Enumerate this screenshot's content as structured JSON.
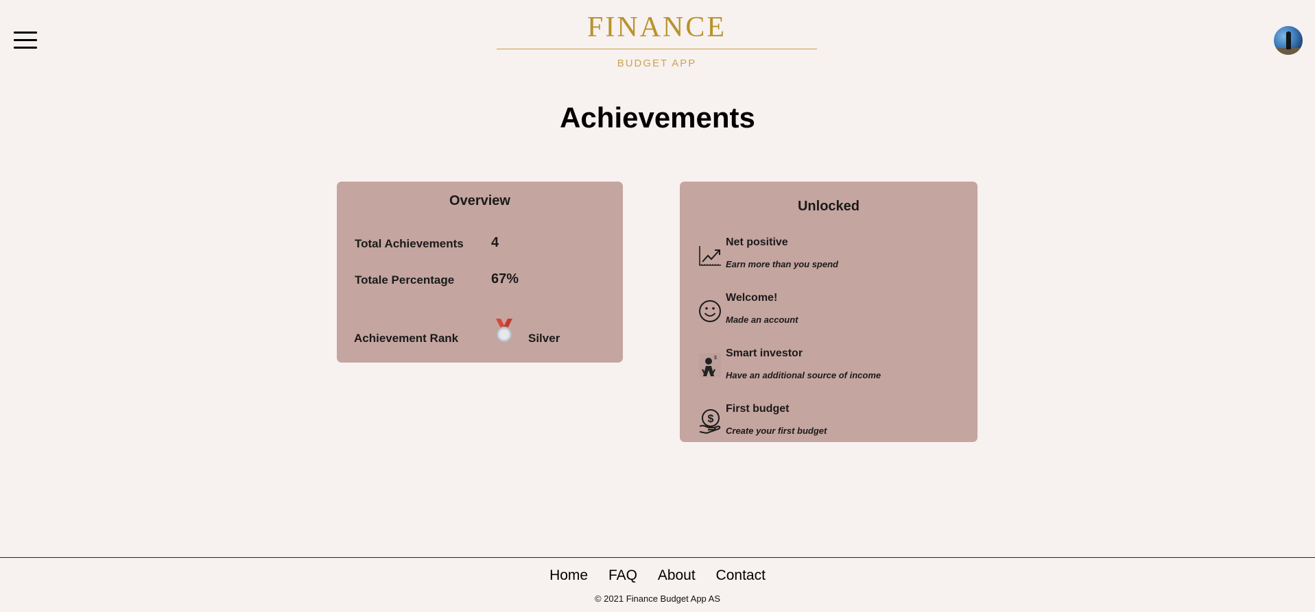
{
  "header": {
    "logo_title": "FINANCE",
    "logo_subtitle": "BUDGET APP",
    "menu_icon": "hamburger-menu-icon",
    "avatar_icon": "user-avatar"
  },
  "page": {
    "title": "Achievements"
  },
  "overview": {
    "title": "Overview",
    "total_label": "Total Achievements",
    "total_value": "4",
    "percentage_label": "Totale Percentage",
    "percentage_value": "67%",
    "rank_label": "Achievement Rank",
    "rank_icon": "silver-medal-icon",
    "rank_value": "Silver"
  },
  "unlocked": {
    "title": "Unlocked",
    "items": [
      {
        "name": "Net positive",
        "description": "Earn more than you spend",
        "icon": "line-chart-icon"
      },
      {
        "name": "Welcome!",
        "description": "Made an account",
        "icon": "smiley-icon"
      },
      {
        "name": "Smart investor",
        "description": "Have an additional source of income",
        "icon": "investor-icon"
      },
      {
        "name": "First budget",
        "description": "Create your first budget",
        "icon": "money-hand-icon"
      }
    ]
  },
  "footer": {
    "links": [
      "Home",
      "FAQ",
      "About",
      "Contact"
    ],
    "copyright": "© 2021 Finance Budget App AS"
  },
  "colors": {
    "background": "#f7f1ef",
    "card": "#c4a59f",
    "gold": "#b8922a"
  }
}
